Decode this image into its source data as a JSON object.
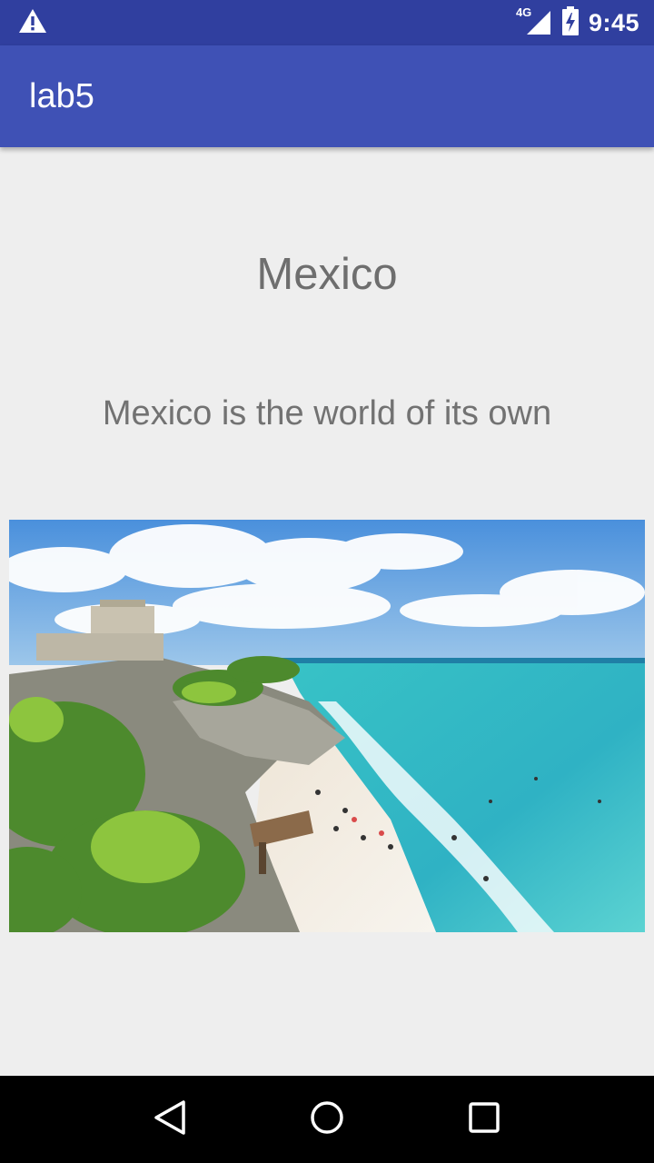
{
  "status_bar": {
    "network_label": "4G",
    "time": "9:45",
    "icons": [
      "warning-icon",
      "signal-icon",
      "battery-charging-icon"
    ]
  },
  "app_bar": {
    "title": "lab5",
    "color": "#3f51b5",
    "status_color": "#303f9f"
  },
  "main": {
    "title": "Mexico",
    "subtitle": "Mexico is the world of its own",
    "image": {
      "description_icon": "beach-photo"
    }
  },
  "nav_bar": {
    "icons": [
      "back-icon",
      "home-icon",
      "recents-icon"
    ]
  }
}
